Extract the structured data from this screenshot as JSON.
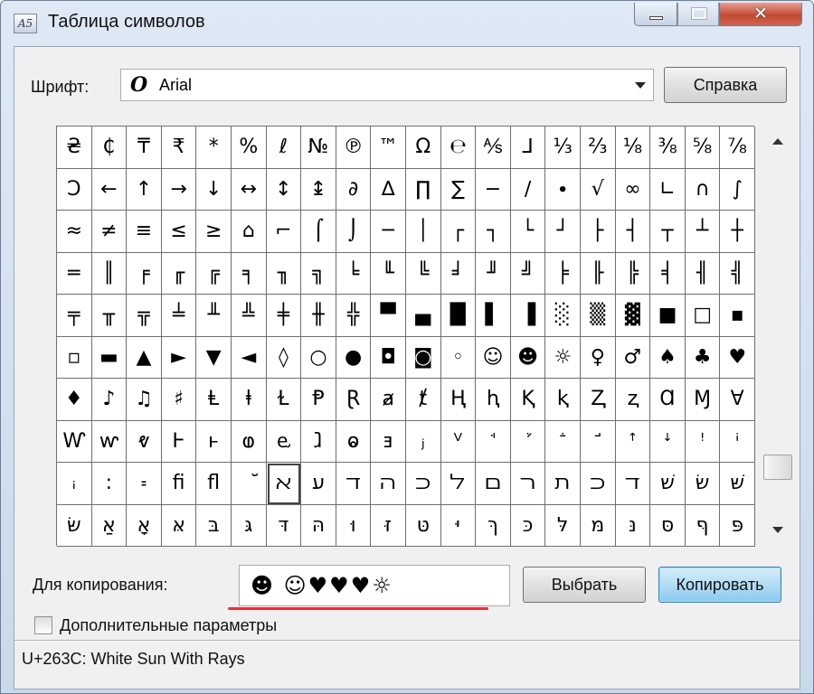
{
  "window": {
    "title": "Таблица символов",
    "icon_text": "A5"
  },
  "font_row": {
    "label": "Шрифт:",
    "font_glyph": "O",
    "font_name": "Arial",
    "help_button": "Справка"
  },
  "grid": {
    "selected_index": 166,
    "cells": [
      "₴",
      "₵",
      "₸",
      "₹",
      "*",
      "%",
      "ℓ",
      "№",
      "℗",
      "™",
      "Ω",
      "℮",
      "⅍",
      "⅃",
      "⅓",
      "⅔",
      "⅛",
      "⅜",
      "⅝",
      "⅞",
      "Ↄ",
      "←",
      "↑",
      "→",
      "↓",
      "↔",
      "↕",
      "↨",
      "∂",
      "∆",
      "∏",
      "∑",
      "−",
      "∕",
      "∙",
      "√",
      "∞",
      "∟",
      "∩",
      "∫",
      "≈",
      "≠",
      "≡",
      "≤",
      "≥",
      "⌂",
      "⌐",
      "⌠",
      "⌡",
      "─",
      "│",
      "┌",
      "┐",
      "└",
      "┘",
      "├",
      "┤",
      "┬",
      "┴",
      "┼",
      "═",
      "║",
      "╒",
      "╓",
      "╔",
      "╕",
      "╖",
      "╗",
      "╘",
      "╙",
      "╚",
      "╛",
      "╜",
      "╝",
      "╞",
      "╟",
      "╠",
      "╡",
      "╢",
      "╣",
      "╤",
      "╥",
      "╦",
      "╧",
      "╨",
      "╩",
      "╪",
      "╫",
      "╬",
      "▀",
      "▄",
      "█",
      "▌",
      "▐",
      "░",
      "▒",
      "▓",
      "■",
      "□",
      "▪",
      "▫",
      "▬",
      "▲",
      "►",
      "▼",
      "◄",
      "◊",
      "○",
      "●",
      "◘",
      "◙",
      "◦",
      "☺",
      "☻",
      "☼",
      "♀",
      "♂",
      "♠",
      "♣",
      "♥",
      "♦",
      "♪",
      "♫",
      "♯",
      "Ⱡ",
      "ⱡ",
      "Ɫ",
      "Ᵽ",
      "Ɽ",
      "ⱥ",
      "ⱦ",
      "Ⱨ",
      "ⱨ",
      "Ⱪ",
      "ⱪ",
      "Ⱬ",
      "ⱬ",
      "Ɑ",
      "Ɱ",
      "Ɐ",
      "Ⱳ",
      "ⱳ",
      "ⱴ",
      "Ⱶ",
      "ⱶ",
      "ⱷ",
      "ⱸ",
      "ⱹ",
      "ⱺ",
      "ⱻ",
      "ⱼ",
      "ⱽ",
      "ꜗ",
      "ꜘ",
      "ꜙ",
      "ꜚ",
      "ꜛ",
      "ꜜ",
      "ꜝ",
      "ꜞ",
      "ꜟ",
      "꞉",
      "꞊",
      "ﬁ",
      "ﬂ",
      "ﬞ",
      "ﬡ",
      "ﬠ",
      "ﬢ",
      "ﬣ",
      "ﬤ",
      "ﬥ",
      "ﬦ",
      "ﬧ",
      "ﬨ",
      "ﬤ",
      "ﬢ",
      "שׁ",
      "שׂ",
      "שּׁ",
      "שּׂ",
      "אַ",
      "אָ",
      "אּ",
      "בּ",
      "גּ",
      "דּ",
      "הּ",
      "וּ",
      "זּ",
      "טּ",
      "יּ",
      "ךּ",
      "כּ",
      "לּ",
      "מּ",
      "נּ",
      "סּ",
      "ףּ",
      "פּ"
    ]
  },
  "copy_row": {
    "label": "Для копирования:",
    "value": "☻ ☺♥♥♥☼",
    "select_button": "Выбрать",
    "copy_button": "Копировать"
  },
  "advanced": {
    "label": "Дополнительные параметры"
  },
  "status": {
    "text": "U+263C: White Sun With Rays"
  },
  "colors": {
    "title_bar": "#c9d9ec",
    "close_button": "#c24a34",
    "primary_button": "#88c9ef",
    "annotation_underline": "#e8303c"
  }
}
